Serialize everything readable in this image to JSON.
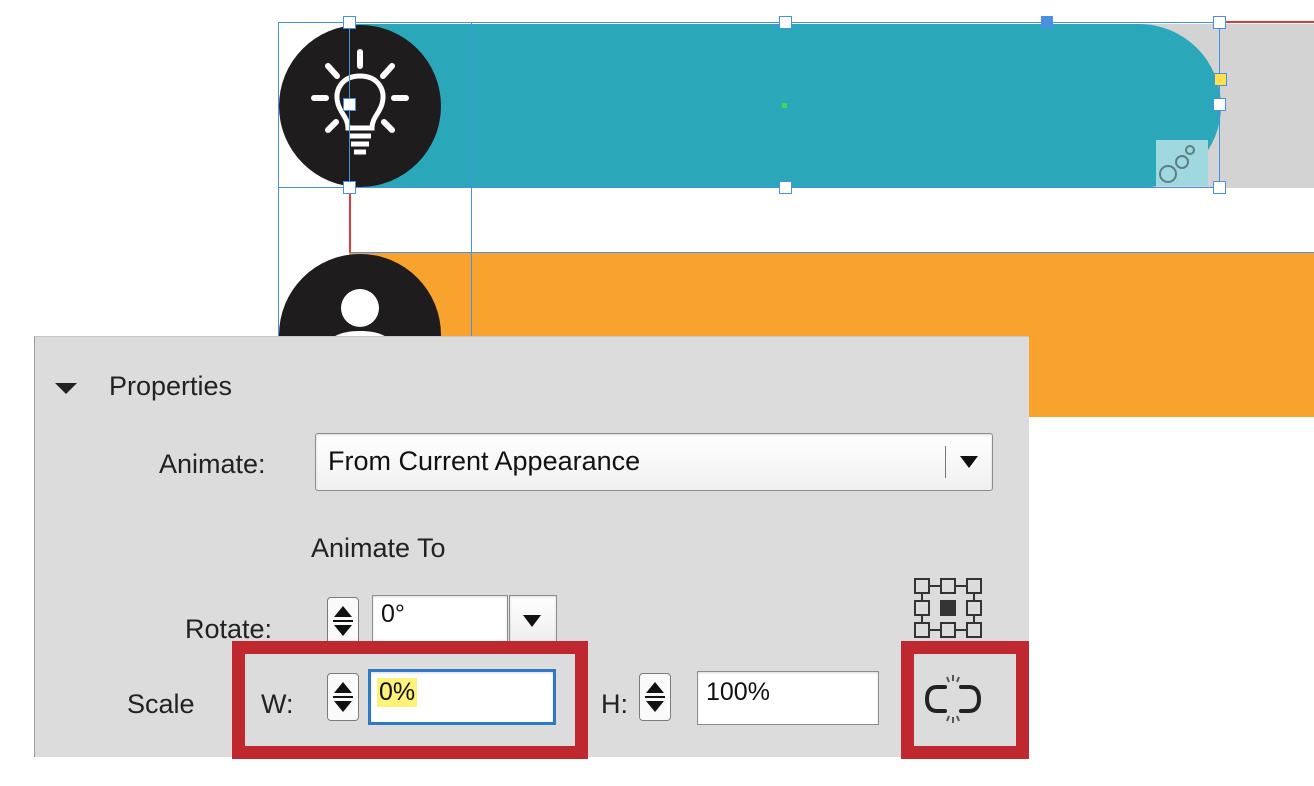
{
  "colors": {
    "teal_bar": "#2aa8b9",
    "orange_bar": "#f9a32f",
    "icon_circle": "#1e1c1d",
    "selection": "#4a90e2",
    "highlight_red": "#c0282f",
    "value_highlight": "#fff27a"
  },
  "canvas": {
    "icons": [
      "lightbulb-icon",
      "person-icon"
    ]
  },
  "panel": {
    "section_title": "Properties",
    "animate_label": "Animate:",
    "animate_value": "From Current Appearance",
    "animate_to_heading": "Animate To",
    "rotate_label": "Rotate:",
    "rotate_value": "0°",
    "scale_label": "Scale",
    "w_label": "W:",
    "w_value": "0%",
    "h_label": "H:",
    "h_value": "100%"
  }
}
